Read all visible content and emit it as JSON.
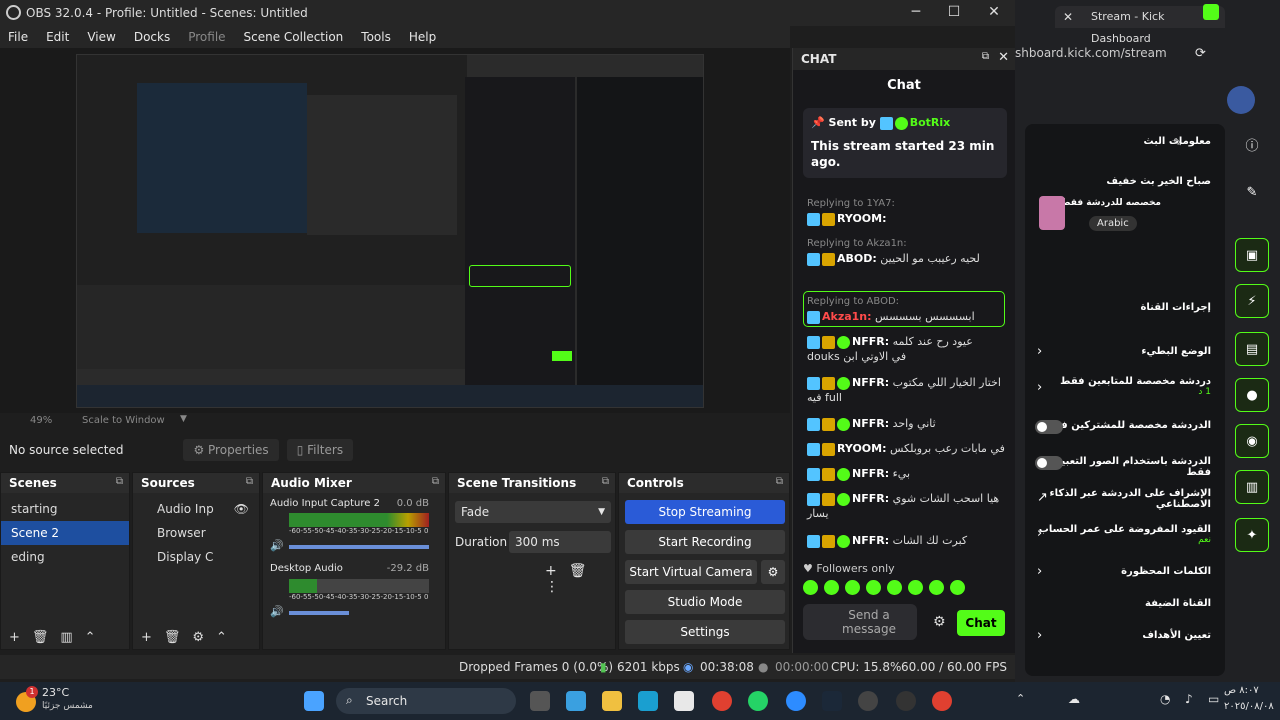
{
  "window": {
    "title": "OBS 32.0.4 - Profile: Untitled - Scenes: Untitled"
  },
  "menu": [
    "File",
    "Edit",
    "View",
    "Docks",
    "Profile",
    "Scene Collection",
    "Tools",
    "Help"
  ],
  "preview": {
    "zoom": "49%",
    "scale_mode": "Scale to Window"
  },
  "source_bar": {
    "no_source": "No source selected",
    "properties": "Properties",
    "filters": "Filters"
  },
  "scenes": {
    "title": "Scenes",
    "items": [
      "starting",
      "Scene 2",
      "eding"
    ],
    "selected": "Scene 2"
  },
  "sources": {
    "title": "Sources",
    "items": [
      "Audio Inp",
      "Browser",
      "Display C"
    ]
  },
  "audio_mixer": {
    "title": "Audio Mixer",
    "channels": [
      {
        "name": "Audio Input Capture 2",
        "db": "0.0 dB"
      },
      {
        "name": "Desktop Audio",
        "db": "-29.2 dB"
      }
    ],
    "scale": "-60-55-50-45-40-35-30-25-20-15-10-5 0"
  },
  "transitions": {
    "title": "Scene Transitions",
    "type": "Fade",
    "duration_label": "Duration",
    "duration": "300 ms"
  },
  "controls": {
    "title": "Controls",
    "stop_streaming": "Stop Streaming",
    "start_recording": "Start Recording",
    "virtual_camera": "Start Virtual Camera",
    "studio_mode": "Studio Mode",
    "settings": "Settings"
  },
  "status": {
    "dropped": "Dropped Frames 0 (0.0%)",
    "kbps": "6201 kbps",
    "live_time": "00:38:08",
    "rec_time": "00:00:00",
    "cpu": "CPU: 15.8%",
    "fps": "60.00 / 60.00 FPS"
  },
  "chat": {
    "dock_title": "CHAT",
    "title": "Chat",
    "pinned": {
      "sent_by": "Sent by",
      "user": "BotRix",
      "text": "This stream started 23 min ago."
    },
    "messages": [
      {
        "reply": "Replying to 1YA7:",
        "user": "RYOOM:",
        "text": ""
      },
      {
        "reply": "Replying to Akza1n:",
        "user": "ABOD:",
        "text": "لحيه رعيبب مو الحيين"
      },
      {
        "reply": "Replying to ABOD:",
        "user": "Akza1n:",
        "text": "ابسسسس بسسسس"
      },
      {
        "reply": "",
        "user": "NFFR:",
        "text": "عيود رح عند كلمه douks في الاوتي ابن"
      },
      {
        "reply": "",
        "user": "NFFR:",
        "text": "اختار الخيار اللي مكتوب فيه full"
      },
      {
        "reply": "",
        "user": "NFFR:",
        "text": "ثاني واحد"
      },
      {
        "reply": "",
        "user": "RYOOM:",
        "text": "في مابات رعب بروبلكس"
      },
      {
        "reply": "",
        "user": "NFFR:",
        "text": "بيء"
      },
      {
        "reply": "",
        "user": "NFFR:",
        "text": "هيا اسحب الشات شوي يسار"
      },
      {
        "reply": "",
        "user": "NFFR:",
        "text": "كبرت لك الشات"
      }
    ],
    "followers": "Followers only",
    "send_placeholder": "Send a message",
    "chat_button": "Chat"
  },
  "browser": {
    "tab": "Stream - Kick Dashboard",
    "url": "shboard.kick.com/stream",
    "stream_info_title": "معلومات البث",
    "stream_title": "صباح الخير بث خفيف",
    "stream_sub": "مخصصه للدردشة فقط",
    "language": "Arabic",
    "channel_actions": "إجراءات القناة",
    "rows": [
      {
        "label": "الوضع البطيء",
        "sub": "",
        "control": "chevron"
      },
      {
        "label": "دردشة مخصصة للمتابعين فقط",
        "sub": "1 د",
        "control": "chevron"
      },
      {
        "label": "الدردشة مخصصة للمشتركين فقط",
        "sub": "",
        "control": "toggle"
      },
      {
        "label": "الدردشة باستخدام الصور التعبيرية فقط",
        "sub": "",
        "control": "toggle"
      },
      {
        "label": "الإشراف على الدردشة عبر الذكاء الاصطناعي",
        "sub": "",
        "control": "link"
      },
      {
        "label": "القيود المفروضة على عمر الحساب",
        "sub": "نعم",
        "control": "chevron"
      },
      {
        "label": "الكلمات المحظورة",
        "sub": "",
        "control": "chevron"
      },
      {
        "label": "القناة الضيفة",
        "sub": "",
        "control": "none"
      },
      {
        "label": "تعيين الأهداف",
        "sub": "",
        "control": "chevron"
      }
    ]
  },
  "taskbar": {
    "weather": "23°C",
    "weather_sub": "مشمس جزئيًا",
    "search": "Search",
    "time": "٨:٠٧ ص",
    "date": "٢٠٢٥/٠٨/٠٨",
    "badge": "1"
  }
}
